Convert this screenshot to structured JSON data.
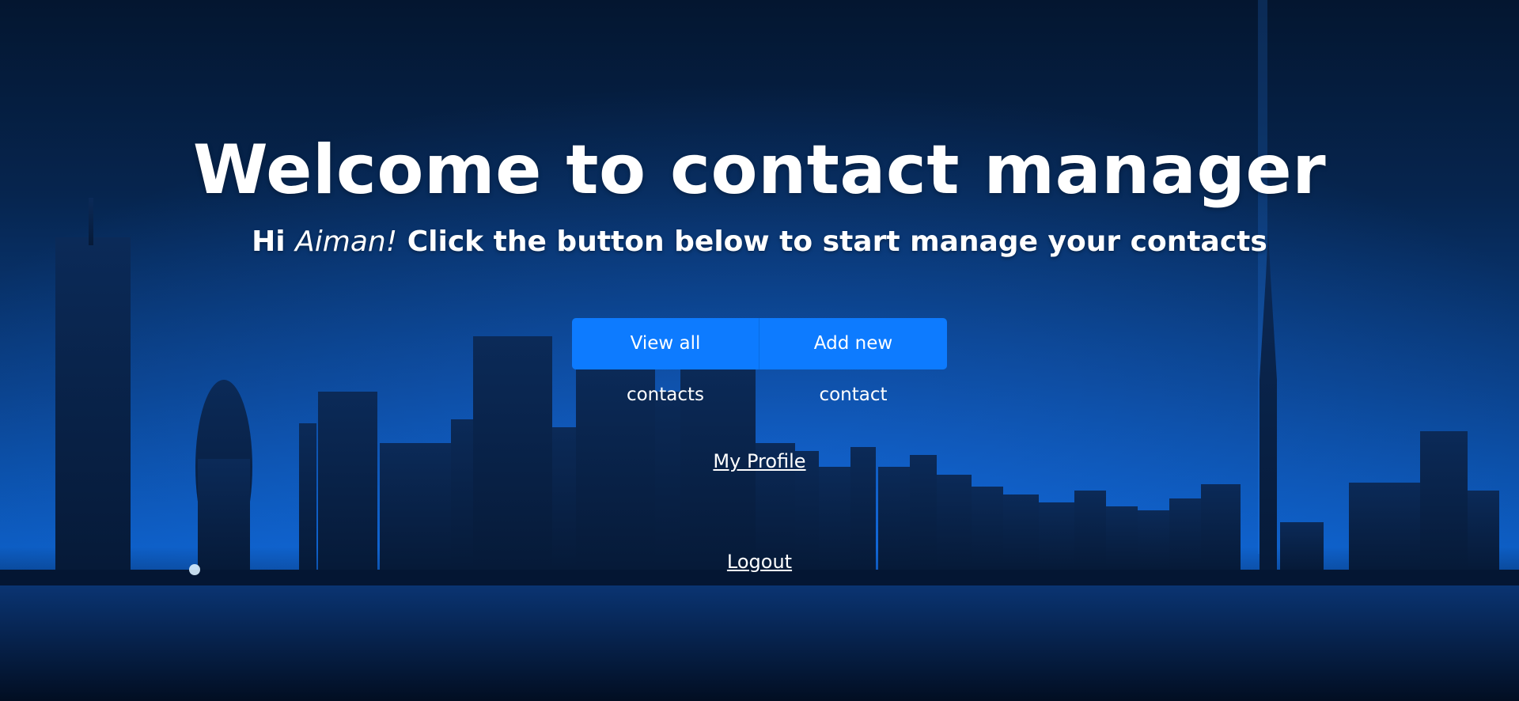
{
  "header": {
    "title": "Welcome to contact manager",
    "subtitle_prefix": "Hi ",
    "user_name": "Aiman!",
    "subtitle_suffix": " Click the button below to start manage your contacts"
  },
  "actions": {
    "view_all_label": "View all contacts",
    "add_new_label": "Add new contact"
  },
  "links": {
    "profile_label": "My Profile",
    "logout_label": "Logout"
  },
  "colors": {
    "button_primary": "#0d7bff",
    "text": "#ffffff"
  }
}
